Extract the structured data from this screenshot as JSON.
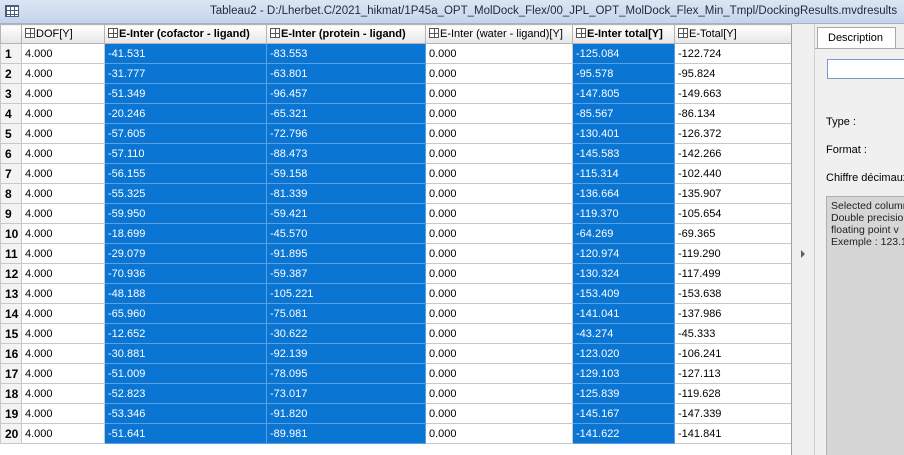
{
  "window": {
    "title": "Tableau2 - D:/Lherbet.C/2021_hikmat/1P45a_OPT_MolDock_Flex/00_JPL_OPT_MolDock_Flex_Min_Tmpl/DockingResults.mvdresults",
    "icon": "table-icon"
  },
  "grid": {
    "columns": [
      {
        "label": "DOF[Y]",
        "selected": false
      },
      {
        "label": "E-Inter (cofactor - ligand)",
        "selected": true
      },
      {
        "label": "E-Inter (protein - ligand)",
        "selected": true
      },
      {
        "label": "E-Inter (water - ligand)[Y]",
        "selected": false
      },
      {
        "label": "E-Inter total[Y]",
        "selected": true
      },
      {
        "label": "E-Total[Y]",
        "selected": false
      }
    ],
    "rows": [
      [
        "1",
        "4.000",
        "-41.531",
        "-83.553",
        "0.000",
        "-125.084",
        "-122.724"
      ],
      [
        "2",
        "4.000",
        "-31.777",
        "-63.801",
        "0.000",
        "-95.578",
        "-95.824"
      ],
      [
        "3",
        "4.000",
        "-51.349",
        "-96.457",
        "0.000",
        "-147.805",
        "-149.663"
      ],
      [
        "4",
        "4.000",
        "-20.246",
        "-65.321",
        "0.000",
        "-85.567",
        "-86.134"
      ],
      [
        "5",
        "4.000",
        "-57.605",
        "-72.796",
        "0.000",
        "-130.401",
        "-126.372"
      ],
      [
        "6",
        "4.000",
        "-57.110",
        "-88.473",
        "0.000",
        "-145.583",
        "-142.266"
      ],
      [
        "7",
        "4.000",
        "-56.155",
        "-59.158",
        "0.000",
        "-115.314",
        "-102.440"
      ],
      [
        "8",
        "4.000",
        "-55.325",
        "-81.339",
        "0.000",
        "-136.664",
        "-135.907"
      ],
      [
        "9",
        "4.000",
        "-59.950",
        "-59.421",
        "0.000",
        "-119.370",
        "-105.654"
      ],
      [
        "10",
        "4.000",
        "-18.699",
        "-45.570",
        "0.000",
        "-64.269",
        "-69.365"
      ],
      [
        "11",
        "4.000",
        "-29.079",
        "-91.895",
        "0.000",
        "-120.974",
        "-119.290"
      ],
      [
        "12",
        "4.000",
        "-70.936",
        "-59.387",
        "0.000",
        "-130.324",
        "-117.499"
      ],
      [
        "13",
        "4.000",
        "-48.188",
        "-105.221",
        "0.000",
        "-153.409",
        "-153.638"
      ],
      [
        "14",
        "4.000",
        "-65.960",
        "-75.081",
        "0.000",
        "-141.041",
        "-137.986"
      ],
      [
        "15",
        "4.000",
        "-12.652",
        "-30.622",
        "0.000",
        "-43.274",
        "-45.333"
      ],
      [
        "16",
        "4.000",
        "-30.881",
        "-92.139",
        "0.000",
        "-123.020",
        "-106.241"
      ],
      [
        "17",
        "4.000",
        "-51.009",
        "-78.095",
        "0.000",
        "-129.103",
        "-127.113"
      ],
      [
        "18",
        "4.000",
        "-52.823",
        "-73.017",
        "0.000",
        "-125.839",
        "-119.628"
      ],
      [
        "19",
        "4.000",
        "-53.346",
        "-91.820",
        "0.000",
        "-145.167",
        "-147.339"
      ],
      [
        "20",
        "4.000",
        "-51.641",
        "-89.981",
        "0.000",
        "-141.622",
        "-141.841"
      ]
    ],
    "selection_color": "#0a75d2"
  },
  "panel": {
    "tab_label": "Description",
    "type_label": "Type :",
    "format_label": "Format :",
    "decimals_label": "Chiffre décimaux",
    "info_lines": [
      "Selected column",
      "Double precision",
      "floating point v",
      "Exemple : 123.1"
    ]
  }
}
